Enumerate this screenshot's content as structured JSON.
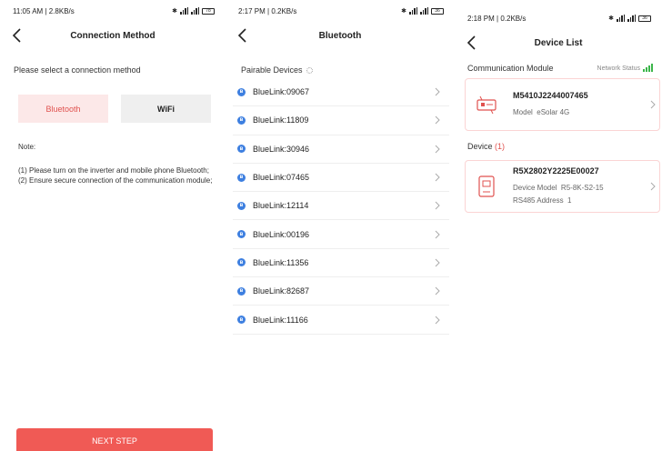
{
  "panels": {
    "connection": {
      "status": {
        "time_speed": "11:05 AM | 2.8KB/s",
        "battery": "78"
      },
      "title": "Connection Method",
      "select_label": "Please select a connection method",
      "methods": {
        "bluetooth": "Bluetooth",
        "wifi": "WiFi"
      },
      "note_label": "Note:",
      "note_lines": [
        "(1) Please turn on the inverter and mobile phone Bluetooth;",
        "(2) Ensure secure connection of the communication module;"
      ],
      "next_label": "NEXT STEP"
    },
    "bluetooth": {
      "status": {
        "time_speed": "2:17 PM | 0.2KB/s",
        "battery": "36"
      },
      "title": "Bluetooth",
      "pairable_label": "Pairable Devices",
      "devices": [
        "BlueLink:09067",
        "BlueLink:11809",
        "BlueLink:30946",
        "BlueLink:07465",
        "BlueLink:12114",
        "BlueLink:00196",
        "BlueLink:11356",
        "BlueLink:82687",
        "BlueLink:11166"
      ]
    },
    "devicelist": {
      "status": {
        "time_speed": "2:18 PM | 0.2KB/s",
        "battery": "36"
      },
      "title": "Device List",
      "comm_module_label": "Communication Module",
      "network_status_label": "Network Status",
      "module": {
        "serial": "M5410J2244007465",
        "model_label": "Model",
        "model": "eSolar 4G"
      },
      "device_label": "Device",
      "device_count": "(1)",
      "device": {
        "serial": "R5X2802Y2225E00027",
        "model_label": "Device Model",
        "model": "R5-8K-S2-15",
        "address_label": "RS485 Address",
        "address": "1"
      }
    }
  },
  "colors": {
    "accent": "#f05a55",
    "bt_blue": "#3d7fe0",
    "signal_green": "#3bb54a"
  }
}
